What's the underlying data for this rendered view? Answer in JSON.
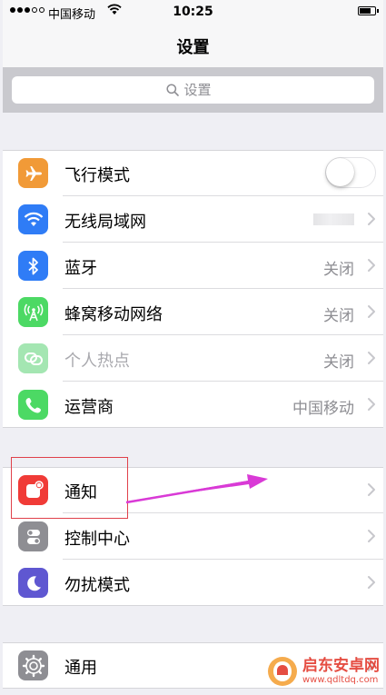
{
  "status": {
    "carrier": "中国移动",
    "time": "10:25",
    "battery_level": 0.8
  },
  "nav": {
    "title": "设置"
  },
  "search": {
    "placeholder": "设置"
  },
  "group1": [
    {
      "id": "airplane",
      "label": "飞行模式",
      "icon": "airplane-icon",
      "color": "#f19a37",
      "control": "toggle",
      "on": false
    },
    {
      "id": "wifi",
      "label": "无线局域网",
      "icon": "wifi-icon",
      "color": "#2f7cf6",
      "control": "blurred"
    },
    {
      "id": "bluetooth",
      "label": "蓝牙",
      "value": "关闭",
      "icon": "bluetooth-icon",
      "color": "#2f7cf6"
    },
    {
      "id": "cellular",
      "label": "蜂窝移动网络",
      "value": "关闭",
      "icon": "cellular-icon",
      "color": "#4cd964"
    },
    {
      "id": "hotspot",
      "label": "个人热点",
      "value": "关闭",
      "icon": "hotspot-icon",
      "color": "#a4e6b2",
      "disabled": true
    },
    {
      "id": "carrier",
      "label": "运营商",
      "value": "中国移动",
      "icon": "phone-icon",
      "color": "#4cd964"
    }
  ],
  "group2": [
    {
      "id": "notifications",
      "label": "通知",
      "icon": "notification-icon",
      "color": "#f03b37"
    },
    {
      "id": "control-center",
      "label": "控制中心",
      "icon": "control-center-icon",
      "color": "#8e8e93"
    },
    {
      "id": "dnd",
      "label": "勿扰模式",
      "icon": "moon-icon",
      "color": "#5f57d1"
    }
  ],
  "group3": [
    {
      "id": "general",
      "label": "通用",
      "icon": "gear-icon",
      "color": "#8e8e93"
    }
  ],
  "watermark": {
    "title": "启东安卓网",
    "url": "www.qdltdq.com"
  },
  "annotations": {
    "highlight_color": "#e0414a",
    "arrow_color": "#d93ad6"
  }
}
